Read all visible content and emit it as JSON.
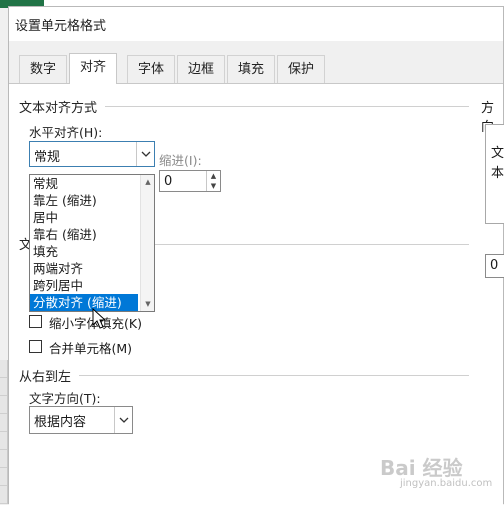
{
  "dialog": {
    "title": "设置单元格格式"
  },
  "tabs": [
    {
      "label": "数字"
    },
    {
      "label": "对齐"
    },
    {
      "label": "字体"
    },
    {
      "label": "边框"
    },
    {
      "label": "填充"
    },
    {
      "label": "保护"
    }
  ],
  "alignment": {
    "section_title": "文本对齐方式",
    "horizontal_label": "水平对齐(H):",
    "horizontal_value": "常规",
    "indent_label": "缩进(I):",
    "indent_value": "0",
    "options": [
      "常规",
      "靠左 (缩进)",
      "居中",
      "靠右 (缩进)",
      "填充",
      "两端对齐",
      "跨列居中",
      "分散对齐 (缩进)"
    ],
    "selected_index": 7,
    "control_initial": "文"
  },
  "text_control": {
    "shrink_label": "缩小字体填充(K)",
    "merge_label": "合并单元格(M)"
  },
  "rtl": {
    "section_title": "从右到左",
    "direction_label": "文字方向(T):",
    "direction_value": "根据内容"
  },
  "orientation": {
    "section_title": "方向",
    "text_line1": "文",
    "text_line2": "本",
    "degrees_value": "0"
  },
  "colors": {
    "selection": "#0078d7",
    "excel_green": "#217346"
  }
}
